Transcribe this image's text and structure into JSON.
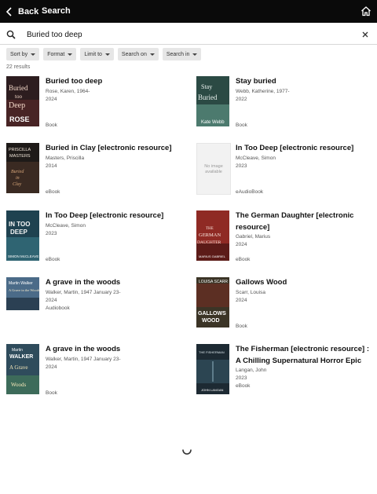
{
  "header": {
    "back_label": "Back",
    "title": "Search"
  },
  "search": {
    "value": "Buried too deep",
    "placeholder": ""
  },
  "filters": [
    {
      "label": "Sort by"
    },
    {
      "label": "Format"
    },
    {
      "label": "Limit to"
    },
    {
      "label": "Search on"
    },
    {
      "label": "Search in"
    }
  ],
  "results_count": "22 results",
  "results": [
    {
      "title": "Buried too deep",
      "creator": "Rose, Karen, 1964-",
      "year": "2024",
      "format": "Book",
      "cover_text": "Buried too Deep",
      "cover_author": "KAREN ROSE",
      "cover_color": "#2d1d1f"
    },
    {
      "title": "Stay buried",
      "creator": "Webb, Katherine, 1977-",
      "year": "2022",
      "format": "Book",
      "cover_text": "Stay Buried",
      "cover_author": "Kate Webb",
      "cover_color": "#2b4a44"
    },
    {
      "title": "Buried in Clay [electronic resource]",
      "creator": "Masters, Priscilla",
      "year": "2014",
      "format": "eBook",
      "cover_text": "PRISCILLA MASTERS",
      "cover_author": "Buried in Clay",
      "cover_color": "#1e1a18"
    },
    {
      "title": "In Too Deep [electronic resource]",
      "creator": "McCleave, Simon",
      "year": "2023",
      "format": "eAudioBook",
      "cover_text": "No image available",
      "cover_author": "",
      "cover_color": "#f2f2f2"
    },
    {
      "title": "In Too Deep [electronic resource]",
      "creator": "McCleave, Simon",
      "year": "2023",
      "format": "eBook",
      "cover_text": "IN TOO DEEP",
      "cover_author": "SIMON McCLEAVE",
      "cover_color": "#1f4250"
    },
    {
      "title": "The German Daughter [electronic resource]",
      "creator": "Gabriel, Marius",
      "year": "2024",
      "format": "eBook",
      "cover_text": "THE GERMAN DAUGHTER",
      "cover_author": "MARIUS GABRIEL",
      "cover_color": "#8f2a24"
    },
    {
      "title": "A grave in the woods",
      "creator": "Walker, Martin, 1947 January 23-",
      "year": "2024",
      "format": "Audiobook",
      "cover_text": "A Grave in the Woods",
      "cover_author": "Martin Walker",
      "cover_color": "#4b6b88"
    },
    {
      "title": "Gallows Wood",
      "creator": "Scarr, Louisa",
      "year": "2024",
      "format": "Book",
      "cover_text": "GALLOWS WOOD",
      "cover_author": "LOUISA SCARR",
      "cover_color": "#3b3426"
    },
    {
      "title": "A grave in the woods",
      "creator": "Walker, Martin, 1947 January 23-",
      "year": "2024",
      "format": "Book",
      "cover_text": "A Grave in the Woods",
      "cover_author": "Martin WALKER",
      "cover_color": "#2f4c5c"
    },
    {
      "title": "The Fisherman [electronic resource] : A Chilling Supernatural Horror Epic",
      "creator": "Langan, John",
      "year": "2023",
      "format": "eBook",
      "cover_text": "THE FISHERMAN",
      "cover_author": "JOHN LANGAN",
      "cover_color": "#1d2a33"
    }
  ]
}
